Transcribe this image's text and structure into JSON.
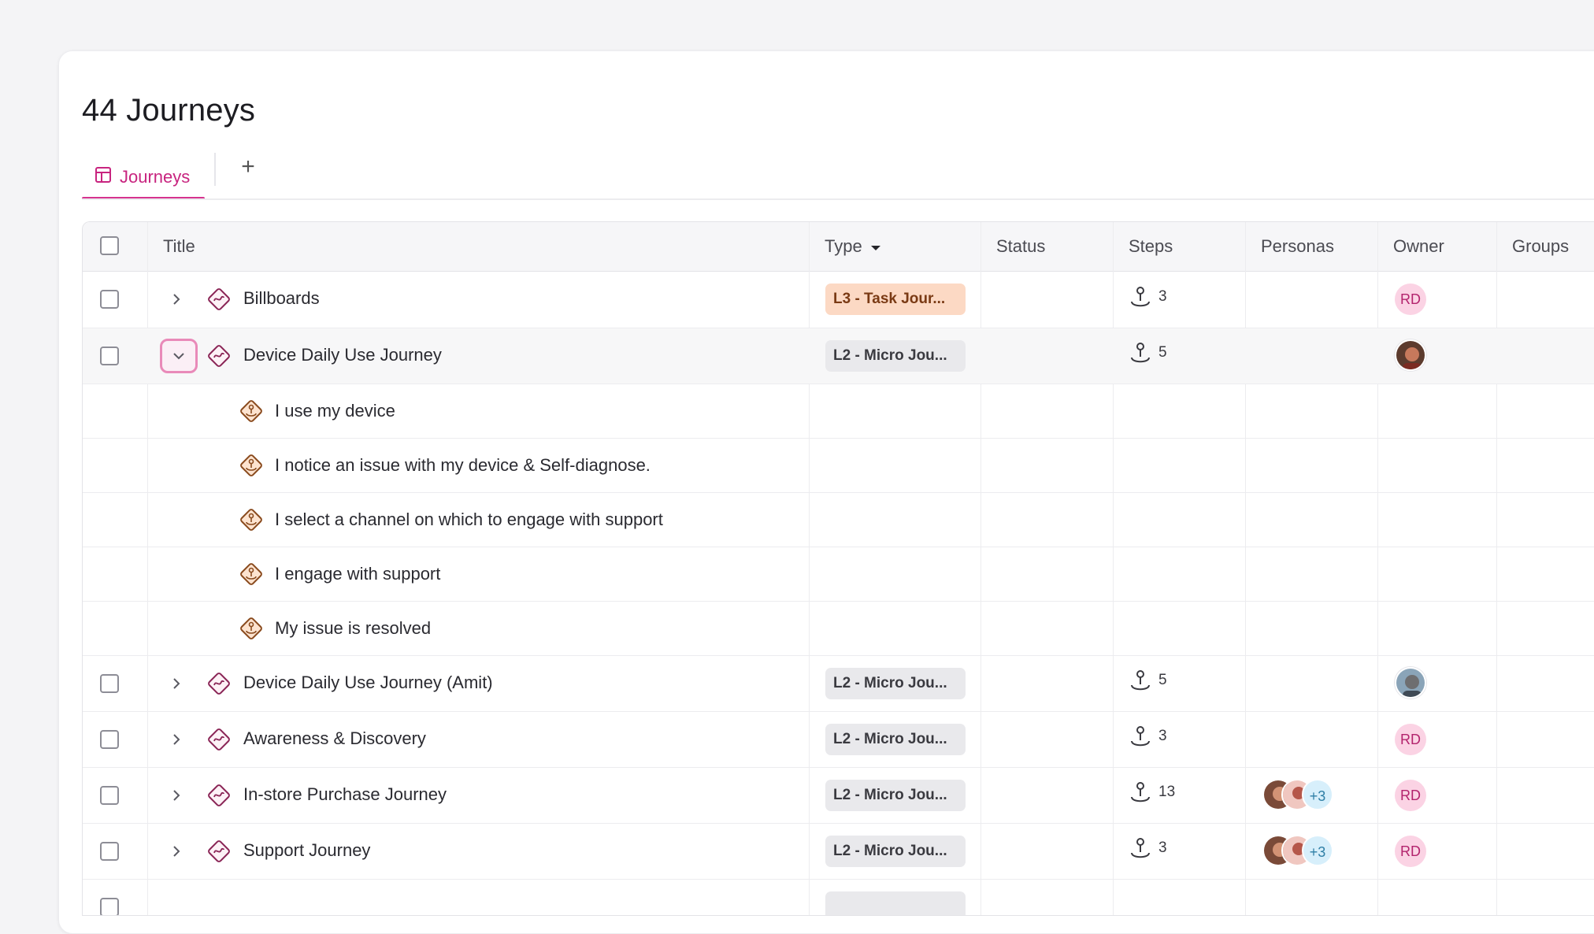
{
  "page": {
    "title": "44 Journeys"
  },
  "tabs": [
    {
      "label": "Journeys",
      "icon": "table-icon",
      "active": true
    }
  ],
  "add_tab": {
    "icon": "plus-icon",
    "label": "+"
  },
  "columns": [
    "Title",
    "Type",
    "Status",
    "Steps",
    "Personas",
    "Owner",
    "Groups"
  ],
  "type_sort_icon": "caret-down-icon",
  "rows": [
    {
      "title": "Billboards",
      "type": "L3 - Task Jour...",
      "type_level": "L3",
      "steps": "3",
      "owner": "RD",
      "expanded": false
    },
    {
      "title": "Device Daily Use Journey",
      "type": "L2 - Micro Jou...",
      "type_level": "L2",
      "steps": "5",
      "owner": "photo",
      "expanded": true,
      "children": [
        {
          "title": "I use my device"
        },
        {
          "title": "I notice an issue with my device & Self-diagnose."
        },
        {
          "title": "I select a channel on which to engage with support"
        },
        {
          "title": "I engage with support"
        },
        {
          "title": "My issue is resolved"
        }
      ]
    },
    {
      "title": "Device Daily Use Journey (Amit)",
      "type": "L2 - Micro Jou...",
      "type_level": "L2",
      "steps": "5",
      "owner": "photo",
      "expanded": false
    },
    {
      "title": "Awareness & Discovery",
      "type": "L2 - Micro Jou...",
      "type_level": "L2",
      "steps": "3",
      "owner": "RD",
      "expanded": false
    },
    {
      "title": "In-store Purchase Journey",
      "type": "L2 - Micro Jou...",
      "type_level": "L2",
      "steps": "13",
      "personas_more": "+3",
      "owner": "RD",
      "expanded": false
    },
    {
      "title": "Support Journey",
      "type": "L2 - Micro Jou...",
      "type_level": "L2",
      "steps": "3",
      "personas_more": "+3",
      "owner": "RD",
      "expanded": false
    }
  ],
  "colors": {
    "accent": "#d6338f",
    "l3_badge": "#fcd9c4",
    "l2_badge": "#e9e9ec",
    "rd_avatar": "#fbd3e4"
  }
}
